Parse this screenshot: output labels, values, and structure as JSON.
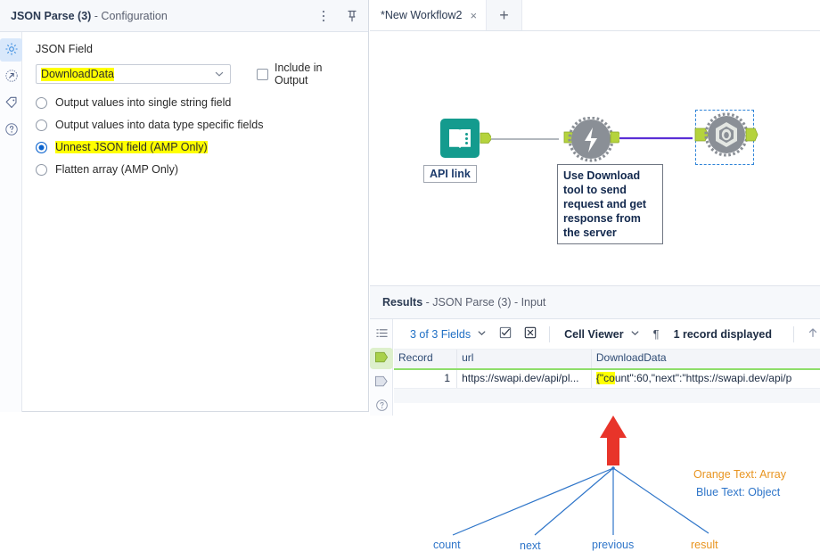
{
  "config_panel": {
    "title_main": "JSON Parse (3)",
    "title_sub": " - Configuration",
    "menu_icon": "kebab-menu-icon",
    "pin_icon": "pin-icon",
    "rail_items": [
      {
        "icon": "gear-icon",
        "active": true
      },
      {
        "icon": "arrow-circle-icon",
        "active": false
      },
      {
        "icon": "tag-icon",
        "active": false
      },
      {
        "icon": "question-circle-icon",
        "active": false
      }
    ],
    "json_field_label": "JSON Field",
    "json_field_value": "DownloadData",
    "include_in_output_label": "Include in Output",
    "include_in_output_checked": false,
    "options": [
      {
        "label": "Output values into single string field",
        "checked": false,
        "highlight": false
      },
      {
        "label": "Output values into data type specific fields",
        "checked": false,
        "highlight": false
      },
      {
        "label": "Unnest JSON field (AMP Only)",
        "checked": true,
        "highlight": true
      },
      {
        "label": "Flatten array (AMP Only)",
        "checked": false,
        "highlight": false
      }
    ]
  },
  "tab_bar": {
    "active_tab_label": "*New Workflow2",
    "close_glyph": "×",
    "new_tab_glyph": "+"
  },
  "canvas": {
    "nodes": [
      {
        "id": "api-link",
        "icon": "text-input-book-icon",
        "label": "API link",
        "selected": false
      },
      {
        "id": "download",
        "icon": "download-lightning-icon",
        "comment": "Use Download tool to send request and get response from the server",
        "selected": false
      },
      {
        "id": "json-parse",
        "icon": "json-parse-gear-icon",
        "selected": true
      }
    ]
  },
  "results": {
    "title_main": "Results",
    "title_sub": " - JSON Parse (3) - Input",
    "rail_items": [
      {
        "icon": "list-view-icon",
        "active": false
      },
      {
        "icon": "green-data-icon",
        "active": true
      },
      {
        "icon": "metadata-icon",
        "active": false
      },
      {
        "icon": "question-circle-icon",
        "active": false
      }
    ],
    "toolbar": {
      "fields_label": "3 of 3 Fields",
      "select_fields_icon": "checkbox-check-icon",
      "deselect_fields_icon": "checkbox-x-icon",
      "cell_viewer_label": "Cell Viewer",
      "pilcrow_glyph": "¶",
      "records_label": "1 record displayed",
      "scroll_up_icon": "arrow-up-icon"
    },
    "grid": {
      "columns": [
        "Record",
        "url",
        "DownloadData"
      ],
      "rows": [
        {
          "record": "1",
          "url": "https://swapi.dev/api/pl...",
          "data_highlight": "{\"co",
          "data_rest": "unt\":60,\"next\":\"https://swapi.dev/api/p"
        }
      ]
    }
  },
  "annotation": {
    "legend": [
      {
        "text": "Orange Text: Array",
        "color": "#e8941f"
      },
      {
        "text": "Blue Text: Object",
        "color": "#2e75c9"
      }
    ],
    "tree_labels": [
      {
        "text": "count",
        "color": "#2e75c9"
      },
      {
        "text": "next",
        "color": "#2e75c9"
      },
      {
        "text": "previous",
        "color": "#2e75c9"
      },
      {
        "text": "result",
        "color": "#e8941f"
      }
    ],
    "arrow_icon": "red-up-arrow-icon"
  },
  "colors": {
    "highlight_yellow": "#ffff00",
    "radio_blue": "#0b63ce",
    "node_teal": "#149b8e",
    "node_gray": "#8a8f96",
    "connector_green": "#b5d33d",
    "connector_purple": "#5b2fd6",
    "selection_blue": "#2f84d8",
    "arrow_red": "#e8342a",
    "link_blue": "#1f6fc4",
    "annot_blue": "#2e75c9",
    "annot_orange": "#e8941f"
  }
}
